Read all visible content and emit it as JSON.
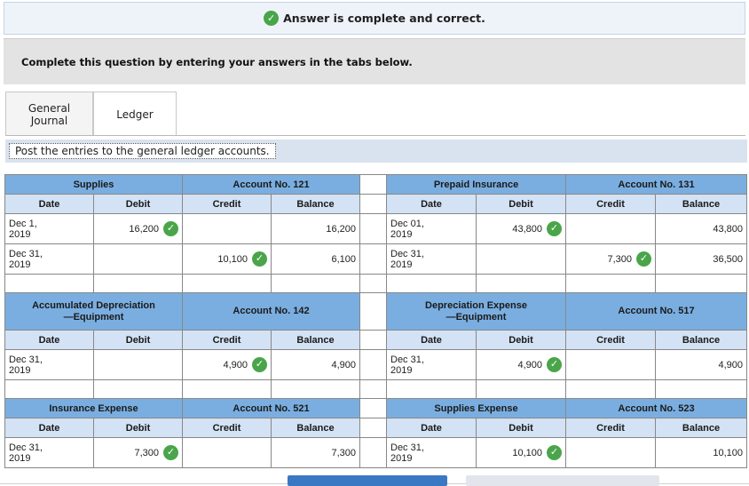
{
  "banner": {
    "text": "Answer is complete and correct."
  },
  "instruction": "Complete this question by entering your answers in the tabs below.",
  "tabs": [
    {
      "label_line1": "General",
      "label_line2": "Journal"
    },
    {
      "label": "Ledger"
    }
  ],
  "post_instruction": "Post the entries to the general ledger accounts.",
  "columns": [
    "Date",
    "Debit",
    "Credit",
    "Balance"
  ],
  "accounts": [
    {
      "name": "Supplies",
      "account_no": "Account No. 121",
      "rows": [
        {
          "date_line1": "Dec 1,",
          "date_line2": "2019",
          "debit": "16,200",
          "credit": "",
          "balance": "16,200"
        },
        {
          "date_line1": "Dec 31,",
          "date_line2": "2019",
          "debit": "",
          "credit": "10,100",
          "balance": "6,100"
        }
      ]
    },
    {
      "name": "Prepaid Insurance",
      "account_no": "Account No. 131",
      "rows": [
        {
          "date_line1": "Dec 01,",
          "date_line2": "2019",
          "debit": "43,800",
          "credit": "",
          "balance": "43,800"
        },
        {
          "date_line1": "Dec 31,",
          "date_line2": "2019",
          "debit": "",
          "credit": "7,300",
          "balance": "36,500"
        }
      ]
    },
    {
      "name_line1": "Accumulated Depreciation",
      "name_line2": "—Equipment",
      "account_no": "Account No. 142",
      "rows": [
        {
          "date_line1": "Dec 31,",
          "date_line2": "2019",
          "debit": "",
          "credit": "4,900",
          "balance": "4,900"
        }
      ]
    },
    {
      "name_line1": "Depreciation Expense",
      "name_line2": "—Equipment",
      "account_no": "Account No. 517",
      "rows": [
        {
          "date_line1": "Dec 31,",
          "date_line2": "2019",
          "debit": "4,900",
          "credit": "",
          "balance": "4,900"
        }
      ]
    },
    {
      "name": "Insurance Expense",
      "account_no": "Account No. 521",
      "rows": [
        {
          "date_line1": "Dec 31,",
          "date_line2": "2019",
          "debit": "7,300",
          "credit": "",
          "balance": "7,300"
        }
      ]
    },
    {
      "name": "Supplies Expense",
      "account_no": "Account No. 523",
      "rows": [
        {
          "date_line1": "Dec 31,",
          "date_line2": "2019",
          "debit": "10,100",
          "credit": "",
          "balance": "10,100"
        }
      ]
    }
  ],
  "icons": {
    "correct": "check-circle-icon"
  },
  "colors": {
    "header": "#7aaee0",
    "subheader": "#d3e2f4",
    "correct": "#4aa54a"
  }
}
